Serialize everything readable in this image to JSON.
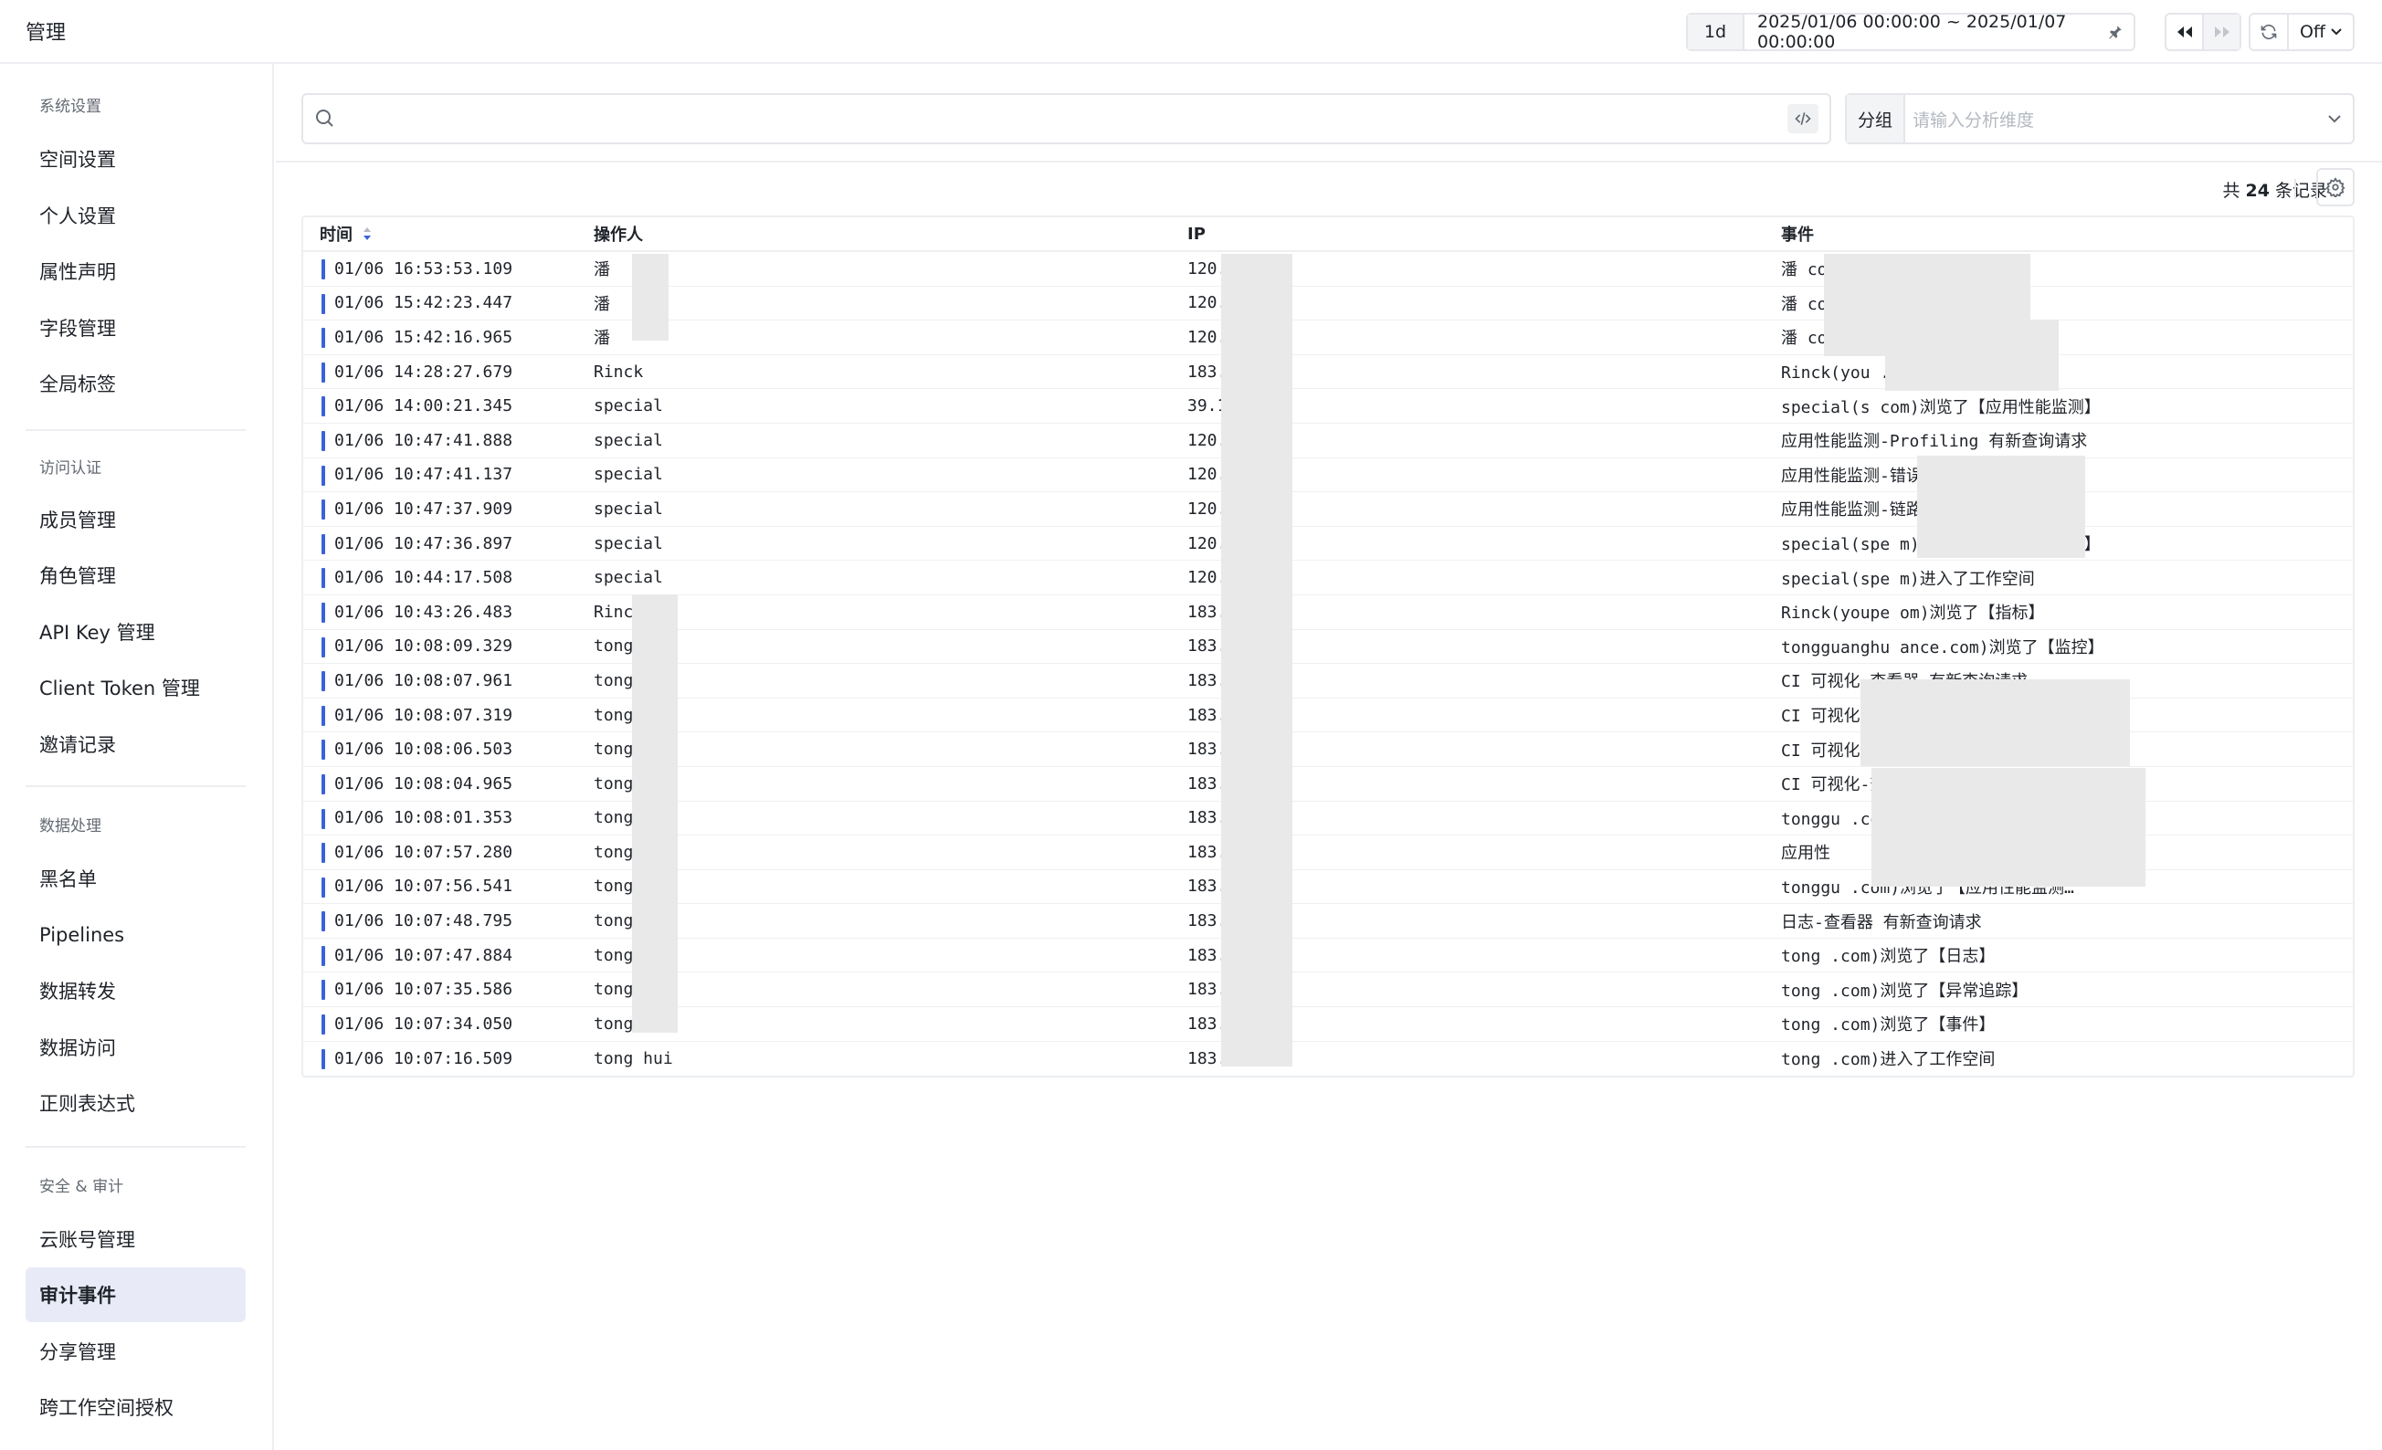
{
  "app": {
    "title": "管理"
  },
  "topbar": {
    "period": "1d",
    "range": "2025/01/06 00:00:00 ~ 2025/01/07 00:00:00",
    "refresh": "Off"
  },
  "sidebar": {
    "sections": [
      {
        "title": "系统设置",
        "items": [
          "空间设置",
          "个人设置",
          "属性声明",
          "字段管理",
          "全局标签"
        ]
      },
      {
        "title": "访问认证",
        "items": [
          "成员管理",
          "角色管理",
          "API Key 管理",
          "Client Token 管理",
          "邀请记录"
        ]
      },
      {
        "title": "数据处理",
        "items": [
          "黑名单",
          "Pipelines",
          "数据转发",
          "数据访问",
          "正则表达式"
        ]
      },
      {
        "title": "安全 & 审计",
        "items": [
          "云账号管理",
          "审计事件",
          "分享管理",
          "跨工作空间授权"
        ]
      }
    ],
    "active": "审计事件"
  },
  "search": {
    "placeholder": ""
  },
  "group": {
    "label": "分组",
    "placeholder": "请输入分析维度"
  },
  "summary": {
    "prefix": "共 ",
    "count": "24",
    "suffix": " 条记录"
  },
  "table": {
    "columns": {
      "time": "时间",
      "operator": "操作人",
      "ip": "IP",
      "event": "事件"
    },
    "rows": [
      {
        "time": "01/06 16:53:53.109",
        "operator": "潘",
        "ip": "120.       .179",
        "event": "潘                  com)进入了工作空间"
      },
      {
        "time": "01/06 15:42:23.447",
        "operator": "潘",
        "ip": "120.       .179",
        "event": "潘                  com)浏览了【监控】"
      },
      {
        "time": "01/06 15:42:16.965",
        "operator": "潘",
        "ip": "120.       .179",
        "event": "潘                  com)进入了工作空间"
      },
      {
        "time": "01/06 14:28:27.679",
        "operator": "Rinck",
        "ip": "183.       0",
        "event": "Rinck(you               .com)浏览了【场景】"
      },
      {
        "time": "01/06 14:00:21.345",
        "operator": "special",
        "ip": "39.1       53",
        "event": "special(s                com)浏览了【应用性能监测】"
      },
      {
        "time": "01/06 10:47:41.888",
        "operator": "special",
        "ip": "120.       .179",
        "event": "应用性能监测-Profiling 有新查询请求"
      },
      {
        "time": "01/06 10:47:41.137",
        "operator": "special",
        "ip": "120.       .179",
        "event": "应用性能监测-错误追踪 有新查询请求"
      },
      {
        "time": "01/06 10:47:37.909",
        "operator": "special",
        "ip": "120.       .179",
        "event": "应用性能监测-链路 有新查询请求"
      },
      {
        "time": "01/06 10:47:36.897",
        "operator": "special",
        "ip": "120.       .179",
        "event": "special(spe              m)浏览了【应用性能监测】"
      },
      {
        "time": "01/06 10:44:17.508",
        "operator": "special",
        "ip": "120.       .179",
        "event": "special(spe              m)进入了工作空间"
      },
      {
        "time": "01/06 10:43:26.483",
        "operator": "Rinck",
        "ip": "183.       0",
        "event": "Rinck(youpe               om)浏览了【指标】"
      },
      {
        "time": "01/06 10:08:09.329",
        "operator": "tong     hui",
        "ip": "183.       .186",
        "event": "tongguanghu              ance.com)浏览了【监控】"
      },
      {
        "time": "01/06 10:08:07.961",
        "operator": "tong     hui",
        "ip": "183.       .186",
        "event": "CI 可视化-查看器 有新查询请求"
      },
      {
        "time": "01/06 10:08:07.319",
        "operator": "tong     hui",
        "ip": "183.       .186",
        "event": "CI 可视化-查看器 有新查询请求"
      },
      {
        "time": "01/06 10:08:06.503",
        "operator": "tong     hui",
        "ip": "183.       .186",
        "event": "CI 可视化-查看器 有新查询请求"
      },
      {
        "time": "01/06 10:08:04.965",
        "operator": "tong     hui",
        "ip": "183.       .186",
        "event": "CI 可视化-查看器 有新查询请求"
      },
      {
        "time": "01/06 10:08:01.353",
        "operator": "tong     hui",
        "ip": "183.       .186",
        "event": "tonggu                      .com)浏览了【CI 可视化】"
      },
      {
        "time": "01/06 10:07:57.280",
        "operator": "tong     hui",
        "ip": "183.       .186",
        "event": "应用性"
      },
      {
        "time": "01/06 10:07:56.541",
        "operator": "tong     hui",
        "ip": "183.       .186",
        "event": "tonggu                      .com)浏览了【应用性能监测…"
      },
      {
        "time": "01/06 10:07:48.795",
        "operator": "tong     hui",
        "ip": "183.       .186",
        "event": "日志-查看器 有新查询请求"
      },
      {
        "time": "01/06 10:07:47.884",
        "operator": "tong     hui",
        "ip": "183.       .186",
        "event": "tong                        .com)浏览了【日志】"
      },
      {
        "time": "01/06 10:07:35.586",
        "operator": "tong     hui",
        "ip": "183.       .186",
        "event": "tong                        .com)浏览了【异常追踪】"
      },
      {
        "time": "01/06 10:07:34.050",
        "operator": "tong     hui",
        "ip": "183.       .186",
        "event": "tong                        .com)浏览了【事件】"
      },
      {
        "time": "01/06 10:07:16.509",
        "operator": "tong     hui",
        "ip": "183.       .186",
        "event": "tong                        .com)进入了工作空间"
      }
    ]
  },
  "colors": {
    "accent": "#3a62d8",
    "active_bg": "#e8ebf7",
    "mask": "#e9e9e9"
  }
}
